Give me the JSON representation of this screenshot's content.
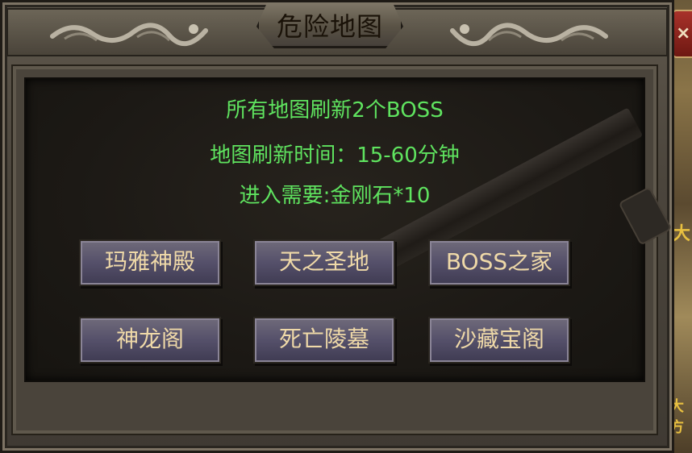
{
  "window": {
    "title": "危险地图",
    "close_label": "×"
  },
  "info": {
    "line1": "所有地图刷新2个BOSS",
    "line2": "地图刷新时间：15-60分钟",
    "line3": "进入需要:金刚石*10"
  },
  "maps": [
    {
      "label": "玛雅神殿"
    },
    {
      "label": "天之圣地"
    },
    {
      "label": "BOSS之家"
    },
    {
      "label": "神龙阁"
    },
    {
      "label": "死亡陵墓"
    },
    {
      "label": "沙藏宝阁"
    }
  ],
  "scene": {
    "glyph1": "大",
    "glyph2": "大方"
  },
  "colors": {
    "info_text": "#5fe35f",
    "button_text": "#efd9a8",
    "title_text": "#1a1208"
  }
}
